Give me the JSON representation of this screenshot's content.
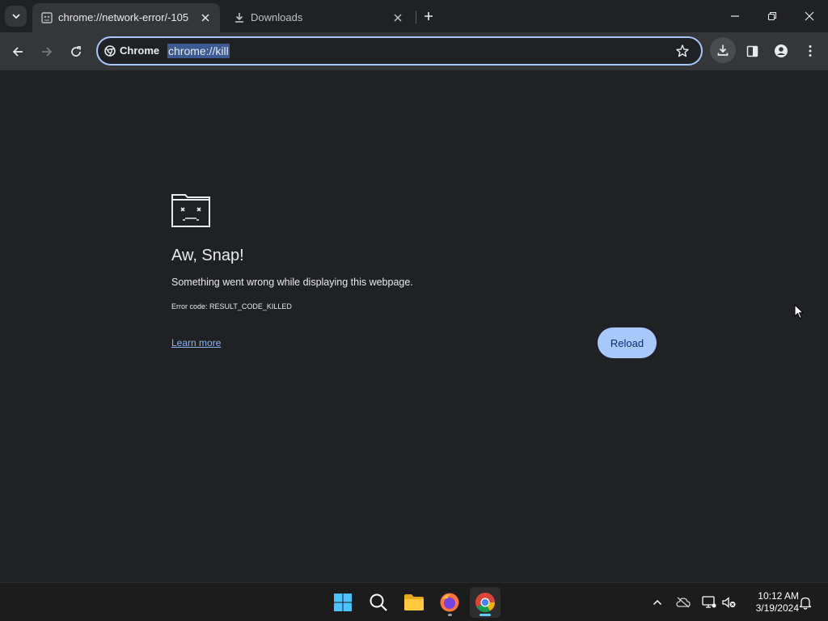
{
  "tabs": [
    {
      "title": "chrome://network-error/-105",
      "active": true
    },
    {
      "title": "Downloads",
      "active": false
    }
  ],
  "omnibox": {
    "chip_label": "Chrome",
    "url": "chrome://kill"
  },
  "error_page": {
    "heading": "Aw, Snap!",
    "description": "Something went wrong while displaying this webpage.",
    "error_code": "Error code: RESULT_CODE_KILLED",
    "learn_more": "Learn more",
    "reload_label": "Reload"
  },
  "taskbar": {
    "time": "10:12 AM",
    "date": "3/19/2024"
  },
  "colors": {
    "background": "#202124",
    "toolbar": "#35363a",
    "accent": "#a8c7fa",
    "link": "#8ab4f8"
  }
}
